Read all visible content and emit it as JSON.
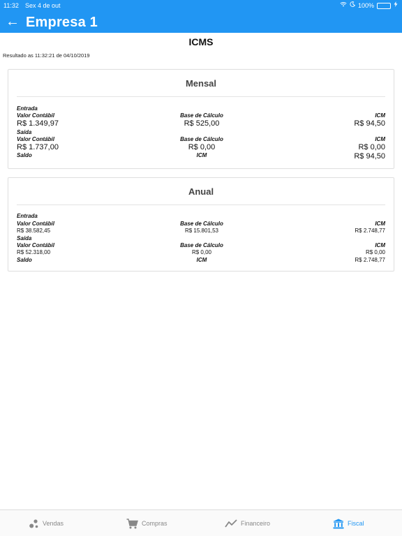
{
  "status_bar": {
    "time": "11:32",
    "date": "Sex 4 de out",
    "battery": "100%"
  },
  "header": {
    "back_icon": "←",
    "title": "Empresa 1"
  },
  "page": {
    "title": "ICMS",
    "result_text": "Resultado as 11:32:21 de 04/10/2019"
  },
  "sections": [
    {
      "title": "Mensal",
      "entrada_label": "Entrada",
      "saida_label": "Saída",
      "saldo_label": "Saldo",
      "col1_label": "Valor Contábil",
      "col2_label": "Base de Cálculo",
      "col3_label": "ICM",
      "entrada": {
        "valor_contabil": "R$ 1.349,97",
        "base_calculo": "R$ 525,00",
        "icm": "R$ 94,50"
      },
      "saida": {
        "valor_contabil": "R$ 1.737,00",
        "base_calculo": "R$ 0,00",
        "icm": "R$ 0,00"
      },
      "saldo": {
        "icm_label": "ICM",
        "icm": "R$ 94,50"
      }
    },
    {
      "title": "Anual",
      "entrada_label": "Entrada",
      "saida_label": "Saída",
      "saldo_label": "Saldo",
      "col1_label": "Valor Contábil",
      "col2_label": "Base de Cálculo",
      "col3_label": "ICM",
      "entrada": {
        "valor_contabil": "R$ 38.582,45",
        "base_calculo": "R$ 15.801,53",
        "icm": "R$ 2.748,77"
      },
      "saida": {
        "valor_contabil": "R$ 52.318,00",
        "base_calculo": "R$ 0,00",
        "icm": "R$ 0,00"
      },
      "saldo": {
        "icm_label": "ICM",
        "icm": "R$ 2.748,77"
      }
    }
  ],
  "tabs": [
    {
      "label": "Vendas",
      "icon": "vendas-icon",
      "active": false
    },
    {
      "label": "Compras",
      "icon": "cart-icon",
      "active": false
    },
    {
      "label": "Financeiro",
      "icon": "chart-line-icon",
      "active": false
    },
    {
      "label": "Fiscal",
      "icon": "bank-icon",
      "active": true
    }
  ],
  "colors": {
    "primary": "#2196f3",
    "tab_inactive": "#888888",
    "battery": "#4cd964"
  }
}
